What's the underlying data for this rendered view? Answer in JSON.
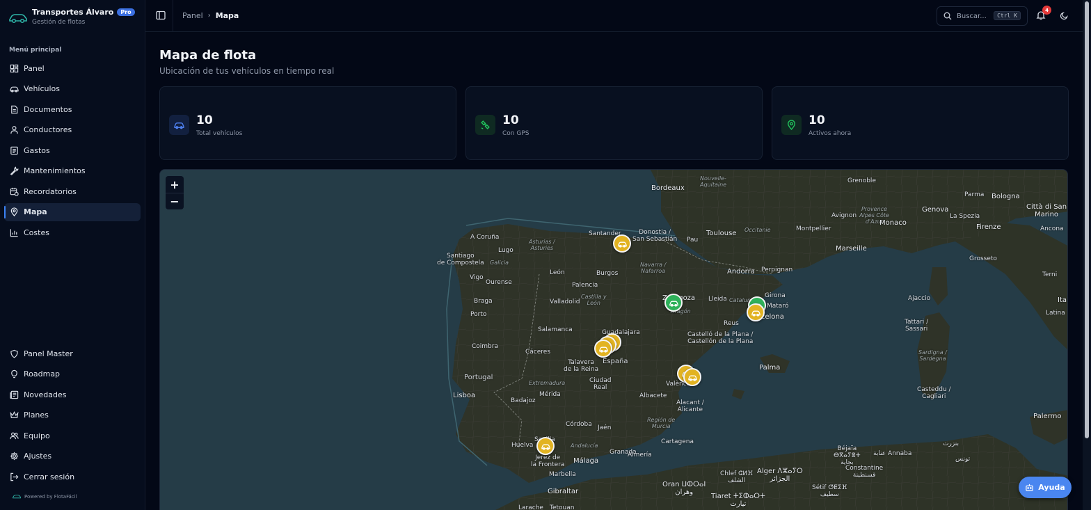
{
  "brand": {
    "title": "Transportes Álvaro",
    "badge": "Pro",
    "subtitle": "Gestión de flotas"
  },
  "sidebar": {
    "section_label": "Menú principal",
    "main_items": [
      {
        "label": "Panel",
        "icon": "dashboard-icon"
      },
      {
        "label": "Vehículos",
        "icon": "car-icon"
      },
      {
        "label": "Documentos",
        "icon": "document-icon"
      },
      {
        "label": "Conductores",
        "icon": "user-icon"
      },
      {
        "label": "Gastos",
        "icon": "receipt-icon"
      },
      {
        "label": "Mantenimientos",
        "icon": "wrench-icon"
      },
      {
        "label": "Recordatorios",
        "icon": "calendar-clock-icon"
      },
      {
        "label": "Mapa",
        "icon": "map-pin-icon",
        "active": true
      },
      {
        "label": "Costes",
        "icon": "bar-chart-icon"
      }
    ],
    "bottom_items": [
      {
        "label": "Panel Master",
        "icon": "shield-icon"
      },
      {
        "label": "Roadmap",
        "icon": "lightbulb-icon"
      },
      {
        "label": "Novedades",
        "icon": "newspaper-icon"
      },
      {
        "label": "Planes",
        "icon": "crown-icon"
      },
      {
        "label": "Equipo",
        "icon": "users-icon"
      },
      {
        "label": "Ajustes",
        "icon": "gear-icon"
      },
      {
        "label": "Cerrar sesión",
        "icon": "logout-icon"
      }
    ],
    "powered_by": "Powered by FlotaFácil"
  },
  "topbar": {
    "breadcrumb_home": "Panel",
    "breadcrumb_current": "Mapa",
    "search_placeholder": "Buscar...",
    "search_shortcut": "Ctrl K",
    "notification_count": "4"
  },
  "page": {
    "title": "Mapa de flota",
    "subtitle": "Ubicación de tus vehículos en tiempo real"
  },
  "stats": [
    {
      "value": "10",
      "label": "Total vehículos",
      "icon": "car-icon",
      "color": "#3b6fe0"
    },
    {
      "value": "10",
      "label": "Con GPS",
      "icon": "satellite-icon",
      "color": "#22c55e"
    },
    {
      "value": "10",
      "label": "Activos ahora",
      "icon": "map-pin-icon",
      "color": "#22c55e"
    }
  ],
  "map": {
    "zoom_in": "+",
    "zoom_out": "−",
    "places": {
      "bordeaux": "Bordeaux",
      "nouvelle_aquitaine": "Nouvelle-\nAquitaine",
      "toulouse": "Toulouse",
      "occitanie": "Occitanie",
      "montpellier": "Montpellier",
      "marseille": "Marseille",
      "avignon": "Avignon",
      "grenoble": "Grenoble",
      "provence": "Provence\nAlpes Côte\nd'Azur",
      "monaco": "Monaco",
      "genova": "Genova",
      "parma": "Parma",
      "bologna": "Bologna",
      "la_spezia": "La Spezia",
      "firenze": "Firenze",
      "citta_san_marino": "Città di San\nMarino",
      "ancona": "Ancona",
      "grosseto": "Grosseto",
      "terni": "Terni",
      "ajaccio": "Ajaccio",
      "tattari": "Tattari /\nSassari",
      "sardigna": "Sardigna /\nSardegna",
      "casteddu": "Casteddu /\nCagliari",
      "italia": "Itali",
      "latina": "Latina",
      "palermo": "Palermo",
      "santander": "Santander",
      "donostia": "Donostia /\nSan Sebastián",
      "pau": "Pau",
      "andorra": "Andorra",
      "perpignan": "Perpignan",
      "girona": "Girona",
      "mataro": "Mataró",
      "barcelona": "Barcelona",
      "lleida": "Lleida",
      "catalunya": "Catalunya",
      "reus": "Reus",
      "zaragoza": "Zaragoza",
      "aragon": "Aragón",
      "navarra": "Navarra /\nNafarroa",
      "a_coruna": "A Coruña",
      "lugo": "Lugo",
      "asturias": "Asturias /\nAsturies",
      "santiago": "Santiago\nde Compostela",
      "galicia": "Galicia",
      "leon": "León",
      "burgos": "Burgos",
      "palencia": "Palencia",
      "vigo": "Vigo",
      "ourense": "Ourense",
      "braga": "Braga",
      "porto": "Porto",
      "valladolid": "Valladolid",
      "castilla_leon": "Castilla y\nLeón",
      "salamanca": "Salamanca",
      "guadalajara": "Guadalajara",
      "espana": "España",
      "coimbra": "Coimbra",
      "portugal": "Portugal",
      "caceres": "Cáceres",
      "talavera": "Talavera\nde la Reina",
      "extremadura": "Extremadura",
      "ciudad_real": "Ciudad\nReal",
      "lisboa": "Lisboa",
      "badajoz": "Badajoz",
      "merida": "Mérida",
      "albacete": "Albacete",
      "castello": "Castelló de la Plana /\nCastellón de la Plana",
      "valencia": "València",
      "alacant": "Alacant /\nAlicante",
      "palma": "Palma",
      "region_murcia": "Región de\nMurcia",
      "cordoba": "Córdoba",
      "jaen": "Jaén",
      "andalucia": "Andalucía",
      "huelva": "Huelva",
      "sevilla": "Sevilla",
      "jerez": "Jerez de\nla Frontera",
      "granada": "Granada",
      "almeria": "Almería",
      "cartagena": "Cartagena",
      "malaga": "Málaga",
      "marbella": "Marbella",
      "gibraltar": "Gibraltar",
      "tetouan": "Tetouan",
      "larache": "Larache",
      "oran": "Oran ⵡⵀⵔⴰⵏ\nوهران",
      "alger": "Alger ⴷⵣⴰⵢⵔ\nالجزائر",
      "chlef": "Chlef ⵛⵍⴼ\nالشلف",
      "bejaia": "Béjaïa\nⴱⴳⴰⵢⴻⵜ\nبجاية",
      "setif": "Sétif ⵚⵟⵉⴼ\nسطيف",
      "tiaret": "Tiaret ⵜⵉⵀⴰⵔⵜ\nتيارت",
      "annaba": "عنابة Annaba",
      "constantine": "Constantine\nقسنطينة",
      "bizerte": "بنزرت",
      "tunis": "تونس"
    }
  },
  "help_button": "Ayuda"
}
